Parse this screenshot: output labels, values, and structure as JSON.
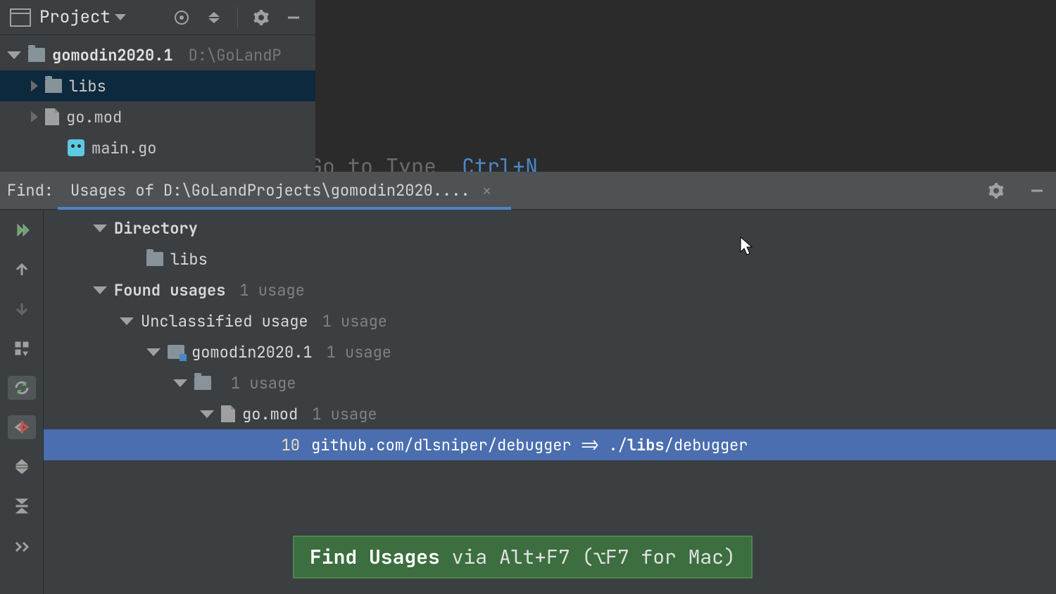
{
  "project": {
    "title": "Project",
    "root": {
      "name": "gomodin2020.1",
      "path": "D:\\GoLandP"
    },
    "items": [
      {
        "name": "libs",
        "type": "folder"
      },
      {
        "name": "go.mod",
        "type": "file"
      },
      {
        "name": "main.go",
        "type": "gofile"
      }
    ]
  },
  "editor": {
    "hint_prefix": "Go to Type",
    "hint_shortcut": "Ctrl+N"
  },
  "find": {
    "label": "Find:",
    "tab": "Usages of D:\\GoLandProjects\\gomodin2020....",
    "directory_heading": "Directory",
    "directory_item": "libs",
    "found_heading": "Found usages",
    "found_count": "1 usage",
    "unclassified_heading": "Unclassified usage",
    "unclassified_count": "1 usage",
    "module_name": "gomodin2020.1",
    "module_count": "1 usage",
    "folder_count": "1 usage",
    "file_name": "go.mod",
    "file_count": "1 usage",
    "usage": {
      "line": "10",
      "prefix": "github.com/dlsniper/debugger => ./",
      "highlight": "libs",
      "suffix": "/debugger"
    }
  },
  "tip": {
    "bold": "Find Usages",
    "rest": "via Alt+F7 (⌥F7 for Mac)"
  }
}
